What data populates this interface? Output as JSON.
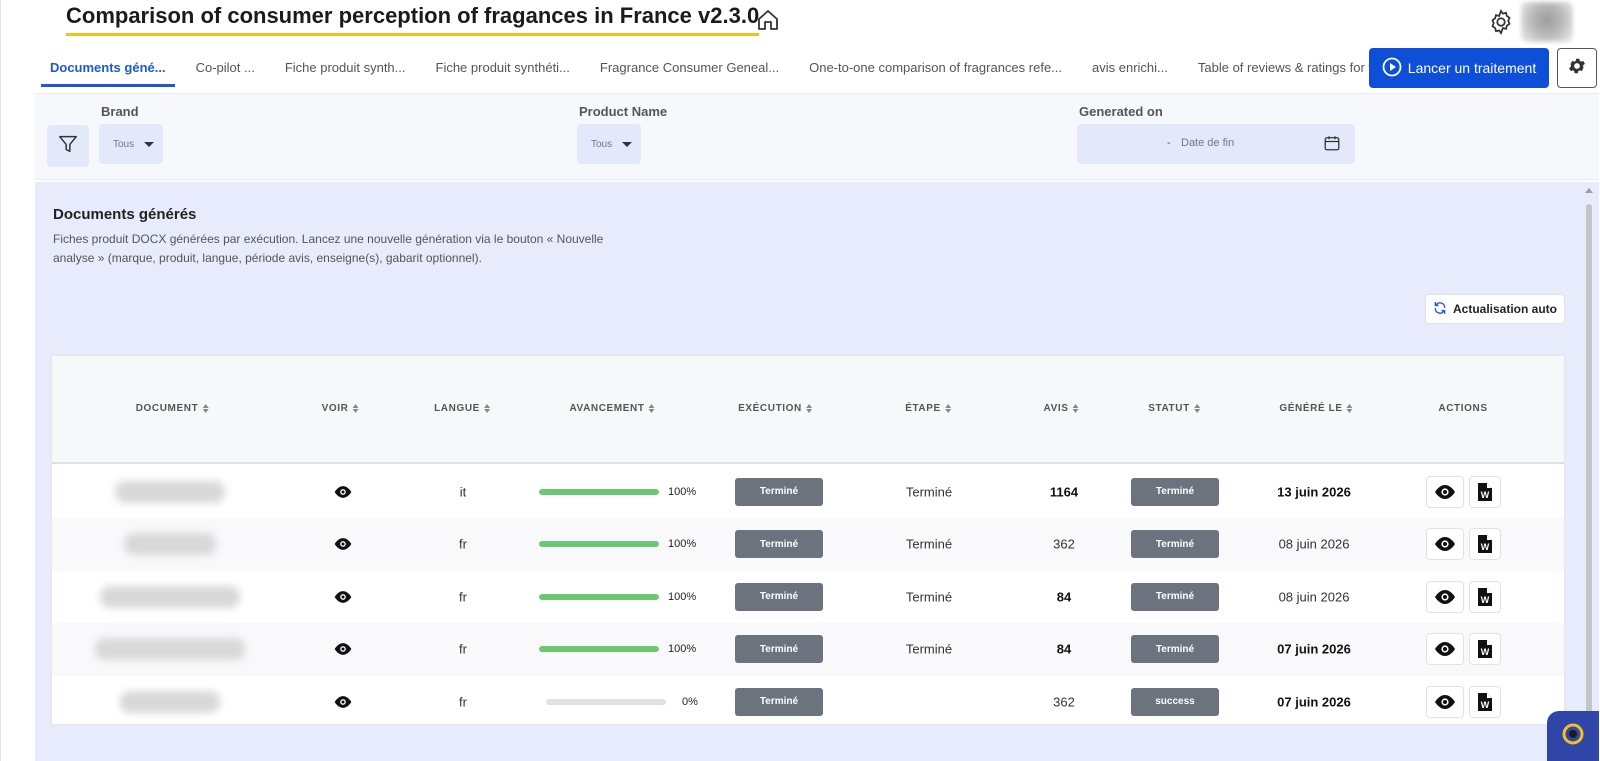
{
  "app": {
    "title": "Comparison of consumer perception of fragances in France v2.3.0"
  },
  "icons": {
    "home": "home-icon",
    "settings": "gear-icon",
    "filter": "filter-icon",
    "calendar": "calendar-icon",
    "refresh": "refresh-icon",
    "eye": "eye-icon",
    "word": "word-document-icon",
    "play": "play-circle-icon",
    "chat": "chat-widget-icon"
  },
  "colors": {
    "primary": "#0d4fd8",
    "title_underline": "#f2c11b",
    "progress_fill": "#6cc773",
    "badge": "#6c737f",
    "content_bg": "#e8ebfb"
  },
  "tabs": [
    {
      "label": "Documents géné...",
      "active": true
    },
    {
      "label": "Co-pilot ...",
      "active": false
    },
    {
      "label": "Fiche produit synth...",
      "active": false
    },
    {
      "label": "Fiche produit synthéti...",
      "active": false
    },
    {
      "label": "Fragrance Consumer Geneal...",
      "active": false
    },
    {
      "label": "One-to-one comparison of fragrances refe...",
      "active": false
    },
    {
      "label": "avis enrichi...",
      "active": false
    },
    {
      "label": "Table of reviews & ratings for frag...",
      "active": false
    }
  ],
  "toolbar": {
    "launch_label": "Lancer un traitement"
  },
  "filters": {
    "brand": {
      "label": "Brand",
      "value": "Tous"
    },
    "product": {
      "label": "Product Name",
      "value": "Tous"
    },
    "generated": {
      "label": "Generated on",
      "separator": "-",
      "end_placeholder": "Date de fin"
    }
  },
  "section": {
    "title": "Documents générés",
    "description": "Fiches produit DOCX générées par exécution. Lancez une nouvelle génération via le bouton « Nouvelle analyse » (marque, produit, langue, période avis, enseigne(s), gabarit optionnel).",
    "refresh_label": "Actualisation auto"
  },
  "table": {
    "columns": [
      "DOCUMENT",
      "VOIR",
      "LANGUE",
      "AVANCEMENT",
      "EXÉCUTION",
      "ÉTAPE",
      "AVIS",
      "STATUT",
      "GÉNÉRÉ LE",
      "ACTIONS"
    ],
    "rows": [
      {
        "langue": "it",
        "progress": 100,
        "progress_label": "100%",
        "execution": "Terminé",
        "etape": "Terminé",
        "avis": "1164",
        "avis_bold": true,
        "statut": "Terminé",
        "genere_le": "13 juin 2026",
        "date_bold": true
      },
      {
        "langue": "fr",
        "progress": 100,
        "progress_label": "100%",
        "execution": "Terminé",
        "etape": "Terminé",
        "avis": "362",
        "avis_bold": false,
        "statut": "Terminé",
        "genere_le": "08 juin 2026",
        "date_bold": false
      },
      {
        "langue": "fr",
        "progress": 100,
        "progress_label": "100%",
        "execution": "Terminé",
        "etape": "Terminé",
        "avis": "84",
        "avis_bold": true,
        "statut": "Terminé",
        "genere_le": "08 juin 2026",
        "date_bold": false
      },
      {
        "langue": "fr",
        "progress": 100,
        "progress_label": "100%",
        "execution": "Terminé",
        "etape": "Terminé",
        "avis": "84",
        "avis_bold": true,
        "statut": "Terminé",
        "genere_le": "07 juin 2026",
        "date_bold": true
      },
      {
        "langue": "fr",
        "progress": 0,
        "progress_label": "0%",
        "execution": "Terminé",
        "etape": "",
        "avis": "362",
        "avis_bold": false,
        "statut": "success",
        "genere_le": "07 juin 2026",
        "date_bold": true
      }
    ]
  }
}
